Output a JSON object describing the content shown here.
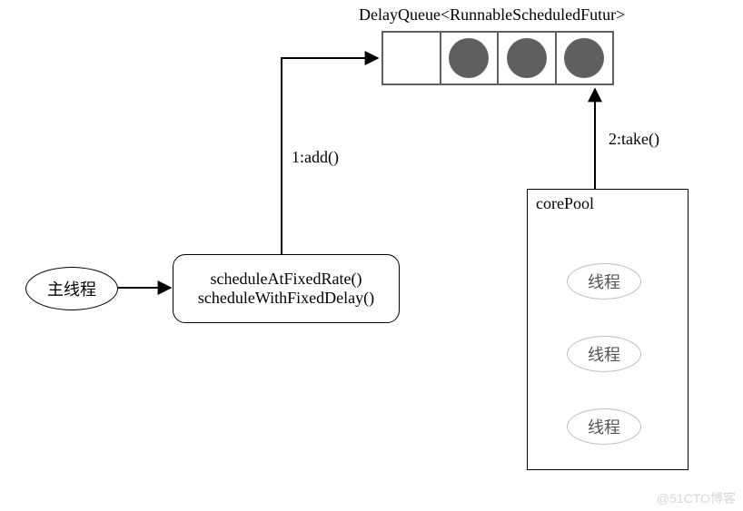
{
  "title": "DelayQueue<RunnableScheduledFutur>",
  "main_thread": "主线程",
  "schedule_box": {
    "line1": "scheduleAtFixedRate()",
    "line2": "scheduleWithFixedDelay()"
  },
  "edges": {
    "add": "1:add()",
    "take": "2:take()"
  },
  "corepool": {
    "title": "corePool",
    "threads": [
      "线程",
      "线程",
      "线程"
    ]
  },
  "queue": {
    "slots": 4,
    "filled": 3
  },
  "watermark": "@51CTO博客"
}
